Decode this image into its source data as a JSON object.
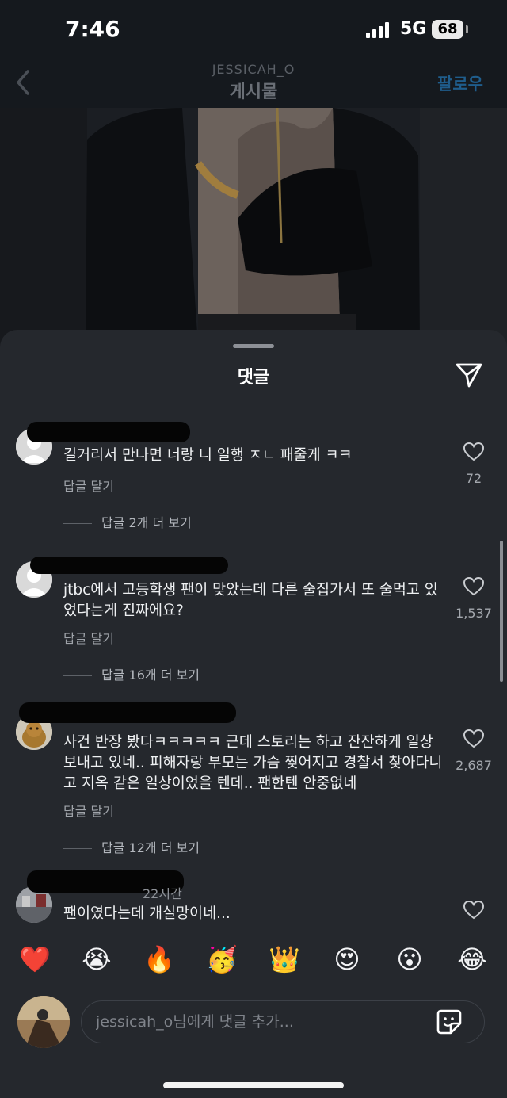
{
  "status_bar": {
    "time": "7:46",
    "network": "5G",
    "battery": "68"
  },
  "header": {
    "username": "JESSICAH_O",
    "title": "게시물",
    "follow": "팔로우"
  },
  "sheet": {
    "title": "댓글"
  },
  "comments": [
    {
      "text": "길거리서 만나면 너랑 니 일행 ㅈㄴ 패줄게 ㅋㅋ",
      "likes": "72",
      "reply": "답글 달기",
      "more": "답글 2개 더 보기"
    },
    {
      "text": "jtbc에서 고등학생 팬이 맞았는데 다른 술집가서 또 술먹고 있었다는게 진짜에요?",
      "likes": "1,537",
      "reply": "답글 달기",
      "more": "답글 16개 더 보기"
    },
    {
      "text": "사건 반장 봤다ㅋㅋㅋㅋㅋ 근데 스토리는 하고 잔잔하게 일상 보내고 있네.. 피해자랑 부모는 가슴 찢어지고 경찰서 찾아다니고 지옥 같은 일상이었을 텐데.. 팬한텐 안중없네",
      "likes": "2,687",
      "reply": "답글 달기",
      "more": "답글 12개 더 보기"
    },
    {
      "text": "팬이였다는데 개실망이네...",
      "time": "22시간"
    }
  ],
  "emojis": [
    "❤️",
    "😭",
    "🔥",
    "🥳",
    "👑",
    "😍",
    "😮",
    "😂"
  ],
  "input": {
    "placeholder": "jessicah_o님에게 댓글 추가..."
  }
}
